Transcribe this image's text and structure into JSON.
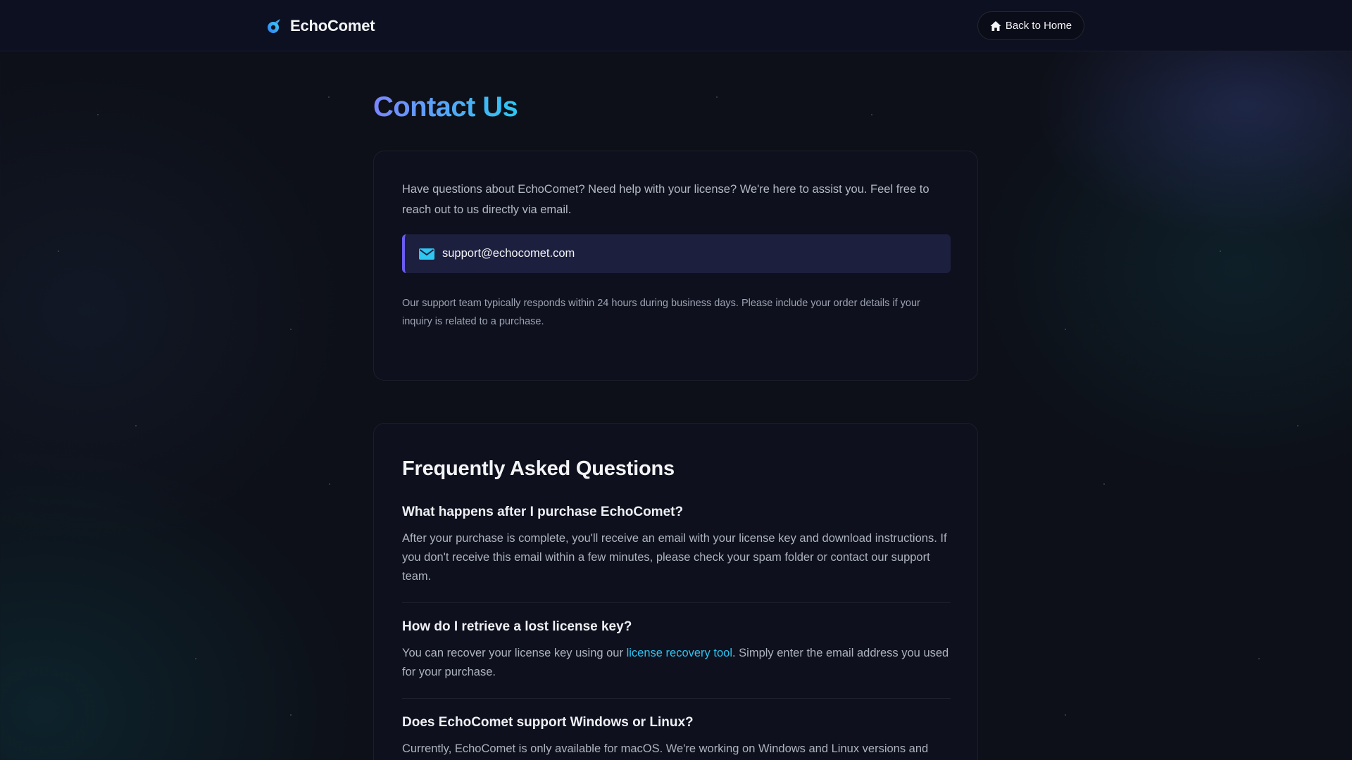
{
  "header": {
    "brand_name": "EchoComet",
    "back_button_label": "Back to Home"
  },
  "page": {
    "title": "Contact Us"
  },
  "contact": {
    "intro": "Have questions about EchoComet? Need help with your license? We're here to assist you. Feel free to reach out to us directly via email.",
    "email": "support@echocomet.com",
    "note": "Our support team typically responds within 24 hours during business days. Please include your order details if your inquiry is related to a purchase."
  },
  "faq": {
    "title": "Frequently Asked Questions",
    "items": [
      {
        "question": "What happens after I purchase EchoComet?",
        "answer": "After your purchase is complete, you'll receive an email with your license key and download instructions. If you don't receive this email within a few minutes, please check your spam folder or contact our support team."
      },
      {
        "question": "How do I retrieve a lost license key?",
        "answer_before": "You can recover your license key using our ",
        "answer_link": "license recovery tool",
        "answer_after": ". Simply enter the email address you used for your purchase."
      },
      {
        "question": "Does EchoComet support Windows or Linux?",
        "answer": "Currently, EchoComet is only available for macOS. We're working on Windows and Linux versions and"
      }
    ]
  },
  "colors": {
    "accent_gradient_start": "#7b86ff",
    "accent_gradient_end": "#2ec6f2",
    "link": "#2ec3f0",
    "email_bar": "#6a5cf0"
  },
  "icons": {
    "brand": "comet-logo-icon",
    "back": "home-icon",
    "email": "envelope-icon"
  }
}
